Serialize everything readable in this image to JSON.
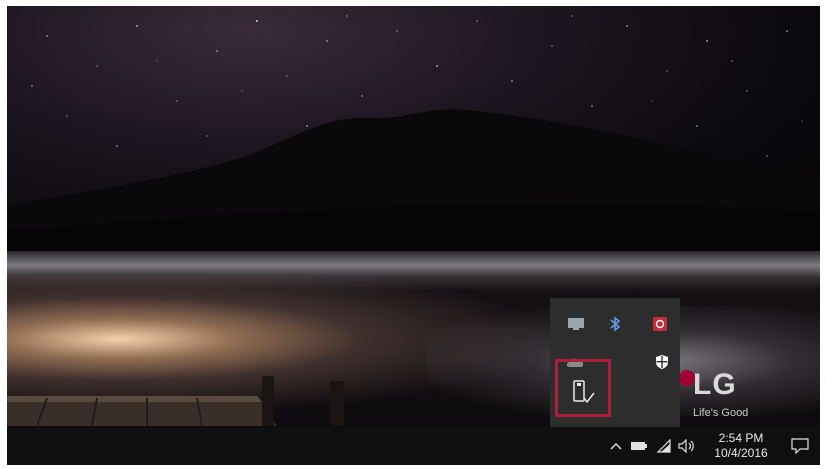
{
  "brand": {
    "logo_text": "LG",
    "tagline": "Life's Good",
    "color": "#a50034"
  },
  "tray_popup": {
    "icons": [
      "display-icon",
      "bluetooth-icon",
      "security-app-icon",
      "cloud-icon",
      "defender-shield-icon",
      "usb-safely-remove-icon"
    ],
    "highlighted": "usb-safely-remove-icon",
    "highlight_color": "#b01e3c"
  },
  "taskbar": {
    "tray_icons": [
      "chevron-up-icon",
      "battery-icon",
      "wifi-icon",
      "volume-icon"
    ],
    "time": "2:54 PM",
    "date": "10/4/2016",
    "notification_icon": "action-center-icon"
  }
}
